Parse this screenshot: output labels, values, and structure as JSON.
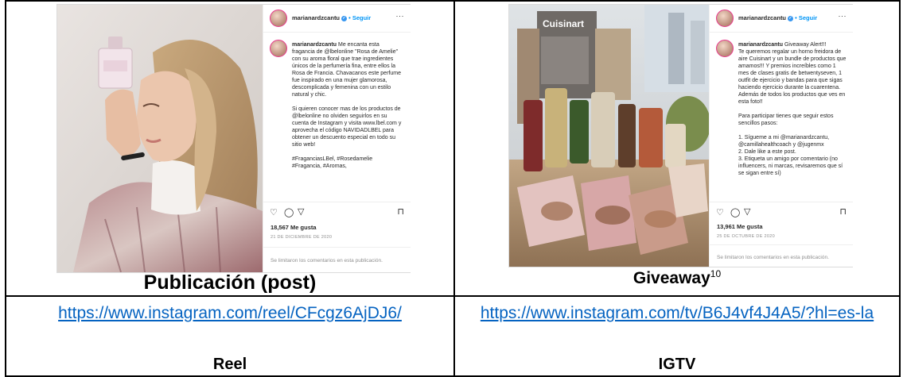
{
  "left_post": {
    "username": "marianardzcantu",
    "follow": "• Seguir",
    "caption_user": "marianardzcantu",
    "caption_text": "Me encanta esta fragancia de @lbelonline \"Rosa de Amelie\" con su aroma floral que trae ingredientes únicos de la perfumería fina, entre ellos la Rosa de Francia. Chavacanos este perfume fue inspirado en una mujer glamorosa, descomplicada y femenina con un estilo natural y chic.\n\nSi quieren conocer mas de los productos de @lbelonline no olviden seguirlos en su cuenta de Instagram y visita www.lbel.com y aprovecha el código NAVIDADLBEL para obtener un descuento especial en todo su sitio web!\n\n#FraganciasLBel, #Rosedamelie #Fragancia, #Aromas,",
    "likes": "18,567 Me gusta",
    "date": "21 DE DICIEMBRE DE 2020",
    "comments_limited": "Se limitaron los comentarios en esta publicación."
  },
  "right_post": {
    "username": "marianardzcantu",
    "follow": "• Seguir",
    "caption_user": "marianardzcantu",
    "caption_text": "Giveaway Alert!!!\nTe queremos regalar un horno freidora de aire Cuisinart y un bundle de productos que amamos!!! Y premios increíbles como 1 mes de clases gratis de betwentyseven, 1 outfit de ejercicio y bandas para que sigas haciendo ejercicio durante la cuarentena. Además de todos los productos que ves en esta foto!!\n\nPara participar tienes que seguir estos sencillos pasos:\n\n1. Sígueme a mi @marianardzcantu, @camillahealthcoach y @jugenmx\n2. Dale like a este post.\n3. Etiqueta un amigo por comentario (no influencers, ni marcas, revisaremos que sí se sigan entre sí)",
    "likes": "13,961 Me gusta",
    "date": "25 DE OCTUBRE DE 2020",
    "comments_limited": "Se limitaron los comentarios en esta publicación."
  },
  "cells": {
    "post_label": "Publicación (post)",
    "giveaway_label": "Giveaway",
    "giveaway_sup": "10",
    "reel_link": "https://www.instagram.com/reel/CFcgz6AjDJ6/",
    "reel_label": "Reel",
    "igtv_link": "https://www.instagram.com/tv/B6J4vf4J4A5/?hl=es-la",
    "igtv_label": "IGTV"
  }
}
